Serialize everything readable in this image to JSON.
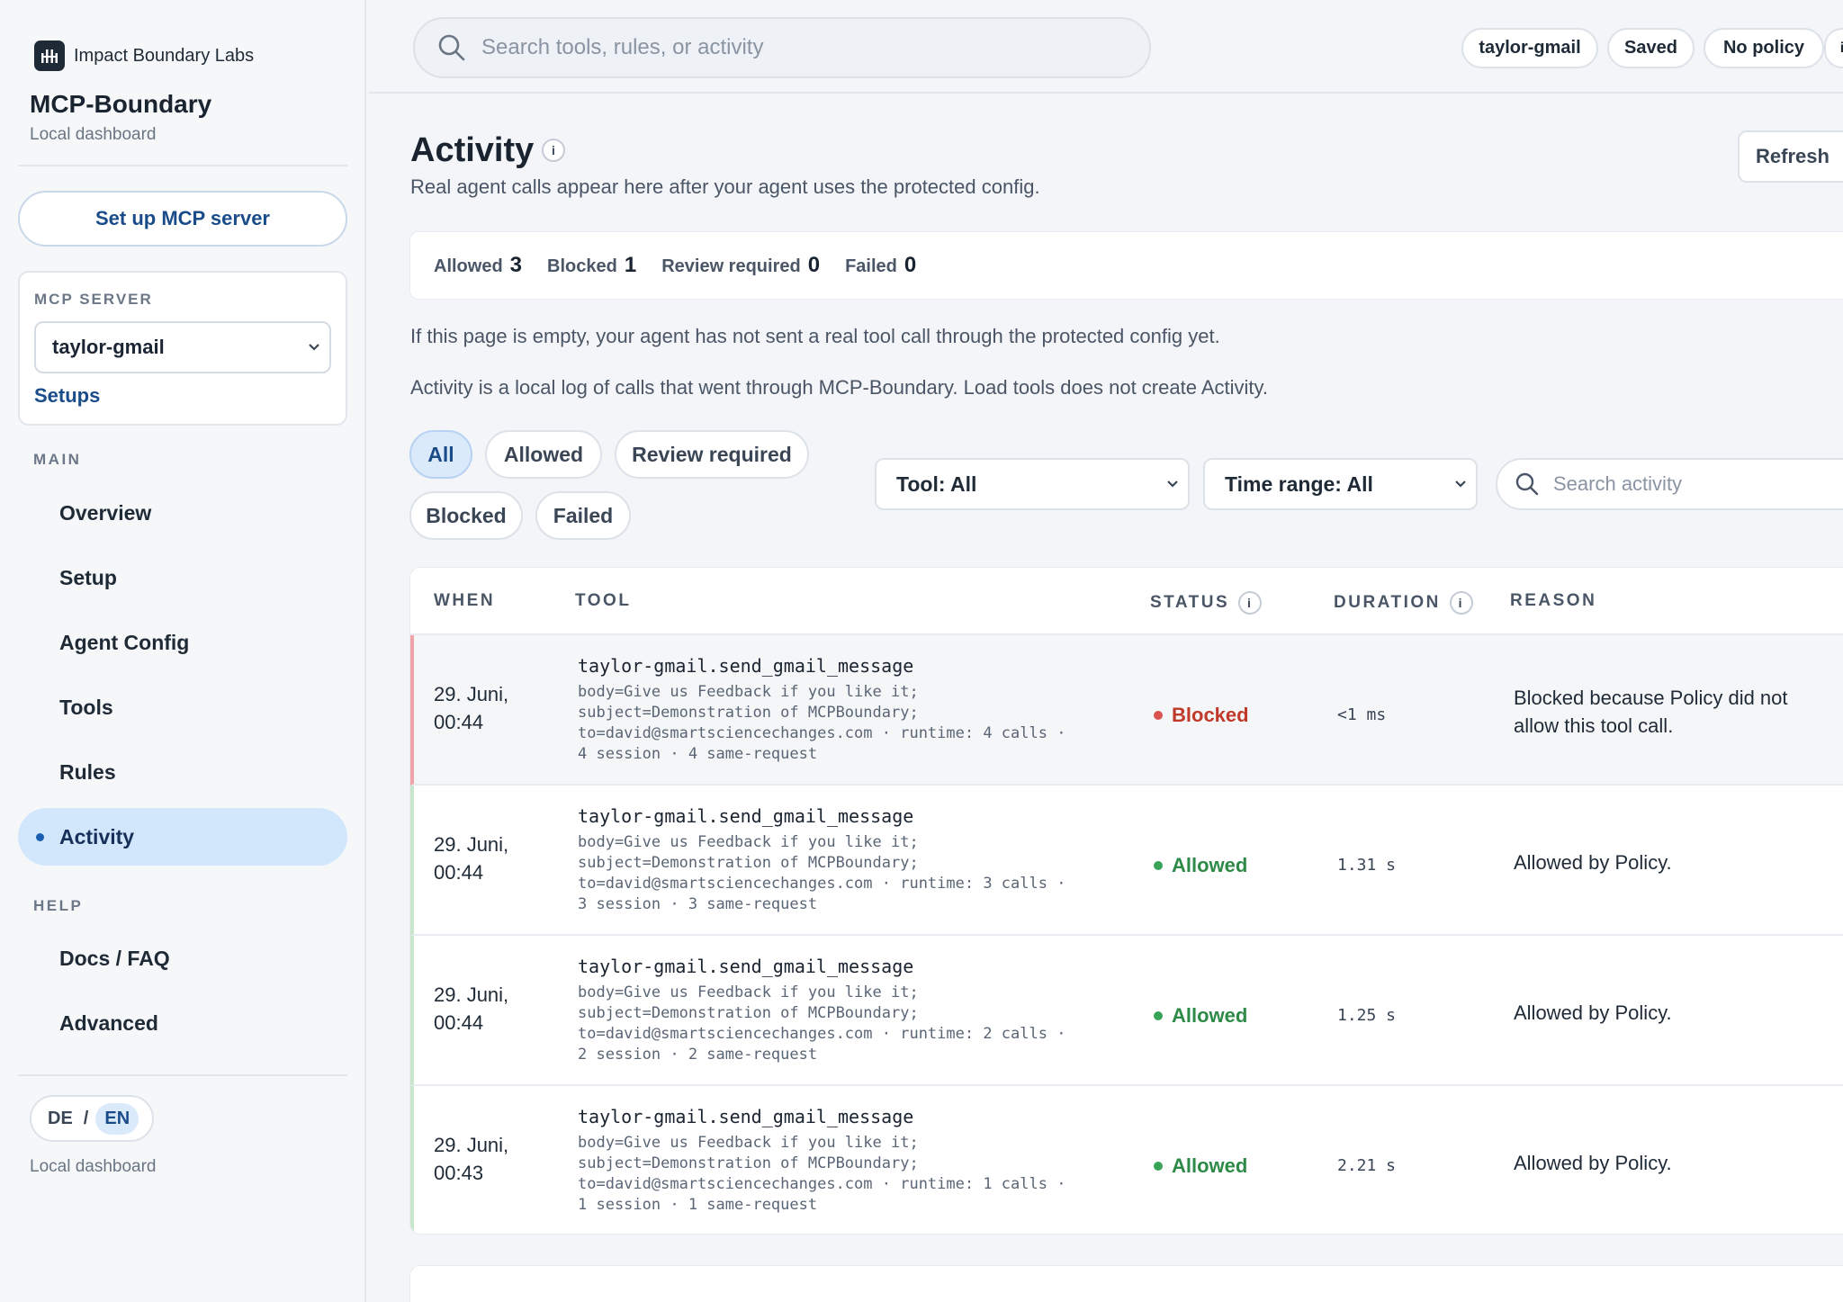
{
  "brand": {
    "name": "Impact Boundary Labs"
  },
  "app": {
    "title": "MCP-Boundary",
    "subtitle": "Local dashboard"
  },
  "sidebar": {
    "setup_button": "Set up MCP server",
    "server": {
      "label": "MCP SERVER",
      "selected": "taylor-gmail",
      "setups_link": "Setups"
    },
    "main_heading": "MAIN",
    "main_items": [
      {
        "label": "Overview"
      },
      {
        "label": "Setup"
      },
      {
        "label": "Agent Config"
      },
      {
        "label": "Tools"
      },
      {
        "label": "Rules"
      },
      {
        "label": "Activity",
        "active": true
      }
    ],
    "help_heading": "HELP",
    "help_items": [
      {
        "label": "Docs / FAQ"
      },
      {
        "label": "Advanced"
      }
    ],
    "lang": {
      "de": "DE",
      "sep": "/",
      "en": "EN"
    },
    "footer": "Local dashboard"
  },
  "topbar": {
    "search_placeholder": "Search tools, rules, or activity",
    "pills": [
      "taylor-gmail",
      "Saved",
      "No policy"
    ],
    "info": "i"
  },
  "page": {
    "title": "Activity",
    "info": "i",
    "subtitle": "Real agent calls appear here after your agent uses the protected config.",
    "refresh": "Refresh"
  },
  "stats": [
    {
      "label": "Allowed",
      "value": "3"
    },
    {
      "label": "Blocked",
      "value": "1"
    },
    {
      "label": "Review required",
      "value": "0"
    },
    {
      "label": "Failed",
      "value": "0"
    }
  ],
  "notes": [
    "If this page is empty, your agent has not sent a real tool call through the protected config yet.",
    "Activity is a local log of calls that went through MCP-Boundary. Load tools does not create Activity."
  ],
  "filters": [
    {
      "label": "All",
      "active": true
    },
    {
      "label": "Allowed"
    },
    {
      "label": "Review required"
    },
    {
      "label": "Blocked"
    },
    {
      "label": "Failed"
    }
  ],
  "dropdowns": {
    "tool": "Tool: All",
    "time": "Time range: All"
  },
  "activity_search_placeholder": "Search activity",
  "table": {
    "headers": {
      "when": "WHEN",
      "tool": "TOOL",
      "status": "STATUS",
      "duration": "DURATION",
      "reason": "REASON"
    },
    "header_info": "i",
    "rows": [
      {
        "when_date": "29. Juni,",
        "when_time": "00:44",
        "tool": "taylor-gmail.send_gmail_message",
        "detail_1": "body=Give us Feedback if you like it;",
        "detail_2": "subject=Demonstration of MCPBoundary;",
        "detail_3": "to=david@smartsciencechanges.com · runtime: 4 calls ·",
        "detail_4": "4 session · 4 same-request",
        "status": "Blocked",
        "duration": "<1 ms",
        "reason": "Blocked because Policy did not allow this tool call."
      },
      {
        "when_date": "29. Juni,",
        "when_time": "00:44",
        "tool": "taylor-gmail.send_gmail_message",
        "detail_1": "body=Give us Feedback if you like it;",
        "detail_2": "subject=Demonstration of MCPBoundary;",
        "detail_3": "to=david@smartsciencechanges.com · runtime: 3 calls ·",
        "detail_4": "3 session · 3 same-request",
        "status": "Allowed",
        "duration": "1.31 s",
        "reason": "Allowed by Policy."
      },
      {
        "when_date": "29. Juni,",
        "when_time": "00:44",
        "tool": "taylor-gmail.send_gmail_message",
        "detail_1": "body=Give us Feedback if you like it;",
        "detail_2": "subject=Demonstration of MCPBoundary;",
        "detail_3": "to=david@smartsciencechanges.com · runtime: 2 calls ·",
        "detail_4": "2 session · 2 same-request",
        "status": "Allowed",
        "duration": "1.25 s",
        "reason": "Allowed by Policy."
      },
      {
        "when_date": "29. Juni,",
        "when_time": "00:43",
        "tool": "taylor-gmail.send_gmail_message",
        "detail_1": "body=Give us Feedback if you like it;",
        "detail_2": "subject=Demonstration of MCPBoundary;",
        "detail_3": "to=david@smartsciencechanges.com · runtime: 1 calls ·",
        "detail_4": "1 session · 1 same-request",
        "status": "Allowed",
        "duration": "2.21 s",
        "reason": "Allowed by Policy."
      }
    ]
  },
  "colors": {
    "blocked": "#c0392b",
    "allowed": "#2e8b47",
    "accent": "#1b4c8a"
  }
}
